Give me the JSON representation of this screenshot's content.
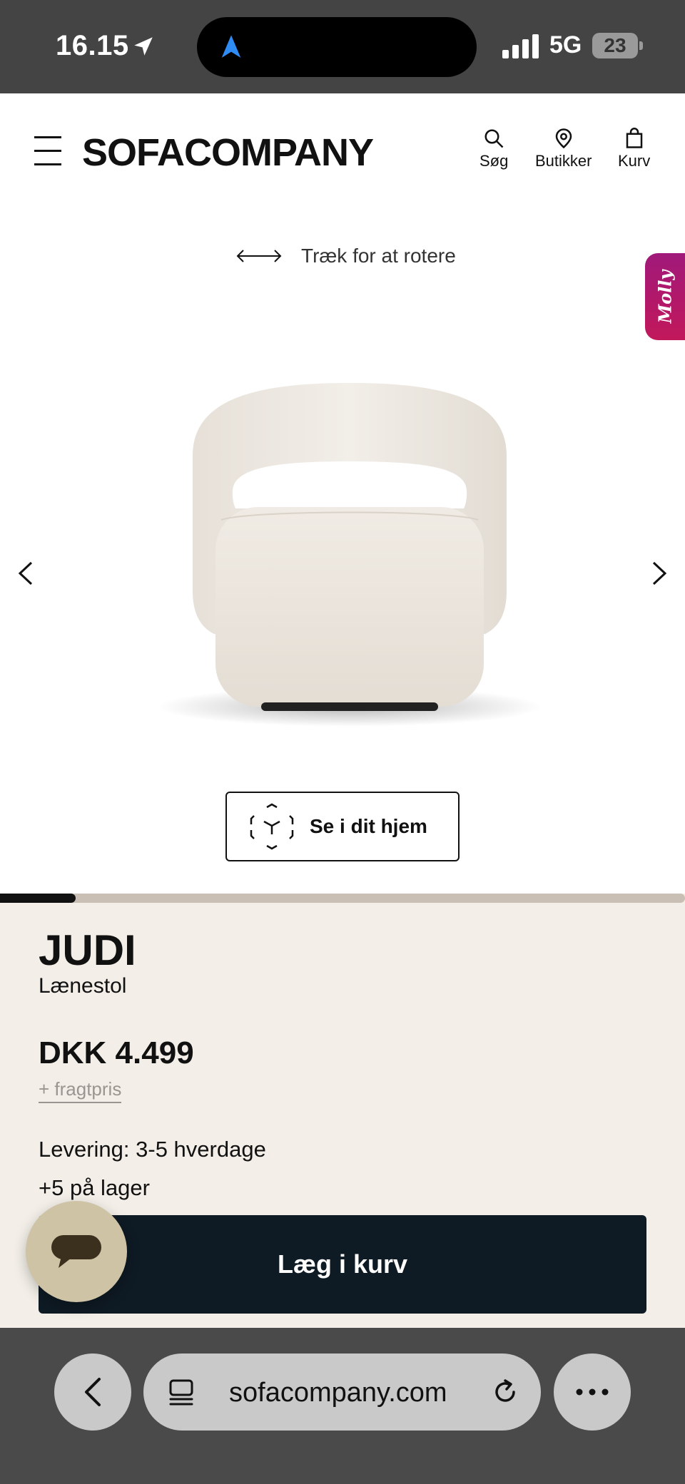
{
  "status_bar": {
    "time": "16.15",
    "network": "5G",
    "battery": "23",
    "icons": [
      "location-arrow-icon",
      "navigation-app-icon",
      "signal-bars-icon",
      "battery-icon"
    ]
  },
  "header": {
    "logo": "SOFACOMPANY",
    "nav": [
      {
        "label": "Søg",
        "icon": "search-icon"
      },
      {
        "label": "Butikker",
        "icon": "location-pin-icon"
      },
      {
        "label": "Kurv",
        "icon": "shopping-bag-icon"
      }
    ]
  },
  "viewer": {
    "rotate_hint": "Træk for at rotere",
    "assistant_tab": "Molly",
    "ar_button": "Se i dit hjem",
    "image_progress": 0.11
  },
  "product": {
    "name": "JUDI",
    "type": "Lænestol",
    "price": "DKK 4.499",
    "freight": "+ fragtpris",
    "delivery": "Levering: 3-5 hverdage",
    "stock": "+5  på lager",
    "cart_button": "Læg i kurv"
  },
  "browser": {
    "url": "sofacompany.com",
    "icons": [
      "back-icon",
      "tabs-icon",
      "reload-icon",
      "more-icon"
    ]
  },
  "colors": {
    "status_bar": "#444444",
    "page_bg": "#f3efe8",
    "cart_button": "#0e1a24",
    "chat_bubble": "#cfc3a6",
    "molly_tab": "#b01870",
    "progress_track": "#c9bfb4"
  }
}
